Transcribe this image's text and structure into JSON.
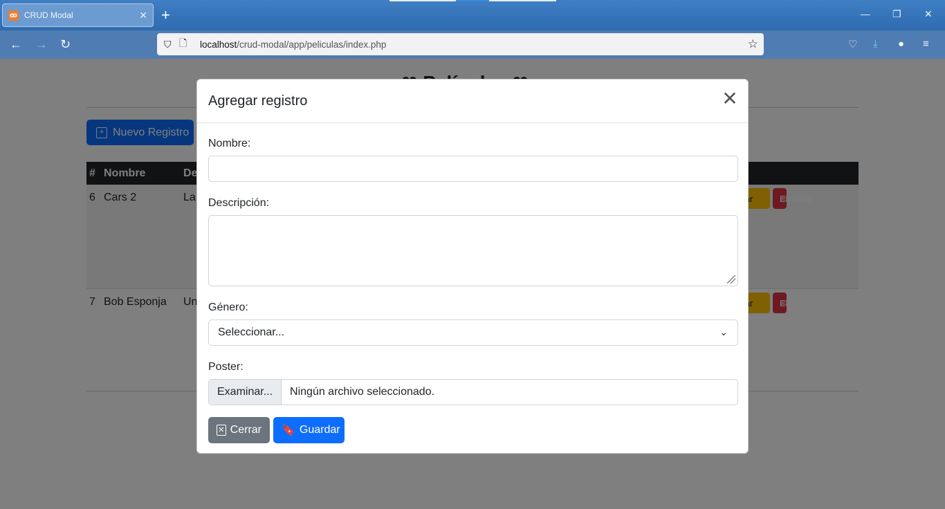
{
  "browser": {
    "tab_title": "CRUD Modal",
    "tab_favicon": "xampp-icon",
    "new_tab_symbol": "+",
    "url_host": "localhost",
    "url_path": "/crud-modal/app/peliculas/index.php"
  },
  "page": {
    "heading": "❤ Películas ❤",
    "new_button_label": "Nuevo Registro",
    "table": {
      "headers": [
        "#",
        "Nombre",
        "De"
      ],
      "rows": [
        {
          "id": "6",
          "nombre": "Cars 2",
          "desc": "La",
          "edit_label": "ditar",
          "delete_label": "Eliminar"
        },
        {
          "id": "7",
          "nombre": "Bob Esponja",
          "desc": "Un",
          "edit_label": "ditar",
          "delete_label": "Eliminar"
        }
      ]
    }
  },
  "modal": {
    "title": "Agregar registro",
    "fields": {
      "nombre_label": "Nombre:",
      "nombre_value": "",
      "descripcion_label": "Descripción:",
      "descripcion_value": "",
      "genero_label": "Género:",
      "genero_selected": "Seleccionar...",
      "poster_label": "Poster:",
      "file_button": "Examinar...",
      "file_status": "Ningún archivo seleccionado."
    },
    "buttons": {
      "close_label": "Cerrar",
      "save_label": "Guardar"
    }
  },
  "colors": {
    "primary": "#0d6efd",
    "secondary": "#6c757d",
    "warning": "#ffc107",
    "danger": "#dc3545",
    "dark": "#212529"
  }
}
